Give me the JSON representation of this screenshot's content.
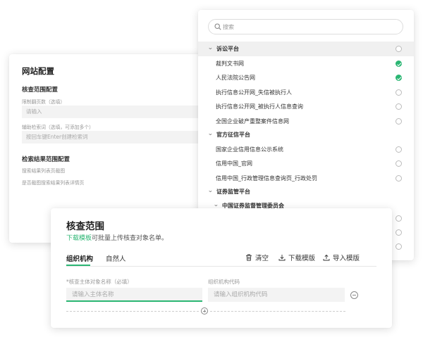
{
  "site_config": {
    "title": "网站配置",
    "scope_section": "核查范围配置",
    "max_pages_label": "限制翻页数（选填）",
    "max_pages_placeholder": "请输入",
    "aux_keywords_label": "辅助检索词（选填，可添加多个）",
    "aux_keywords_placeholder": "按回车键Enter创建检索词",
    "result_section": "检索结果范围配置",
    "result_opt_1": "搜索结果列表页截图",
    "result_opt_2": "是否截图搜索结果列表详情页"
  },
  "platform_list": {
    "search_placeholder": "搜索",
    "groups": [
      {
        "label": "诉讼平台",
        "items": [
          {
            "label": "裁判文书网",
            "checked": true
          },
          {
            "label": "人民法院公告网",
            "checked": true
          },
          {
            "label": "执行信息公开网_失信被执行人",
            "checked": false
          },
          {
            "label": "执行信息公开网_被执行人信息查询",
            "checked": false
          },
          {
            "label": "全国企业破产重整案件信息网",
            "checked": false
          }
        ]
      },
      {
        "label": "官方征信平台",
        "items": [
          {
            "label": "国家企业信用信息公示系统",
            "checked": false
          },
          {
            "label": "信用中国_官网",
            "checked": false
          },
          {
            "label": "信用中国_行政管理信息查询页_行政处罚",
            "checked": false
          }
        ]
      },
      {
        "label": "证券监管平台",
        "subgroups": [
          {
            "label": "中国证券监督管理委员会"
          }
        ]
      }
    ]
  },
  "scope": {
    "title": "核查范围",
    "template_link": "下载模板",
    "hint_rest": "可批量上传核查对象名单。",
    "tabs": [
      "组织机构",
      "自然人"
    ],
    "actions": {
      "clear": "清空",
      "download": "下载模版",
      "import": "导入模版"
    },
    "subject_label": "*核查主体对象名称（必填）",
    "subject_placeholder": "请输入主体名称",
    "code_label": "组织机构代码",
    "code_placeholder": "请输入组织机构代码"
  },
  "colors": {
    "accent": "#2bb673"
  }
}
